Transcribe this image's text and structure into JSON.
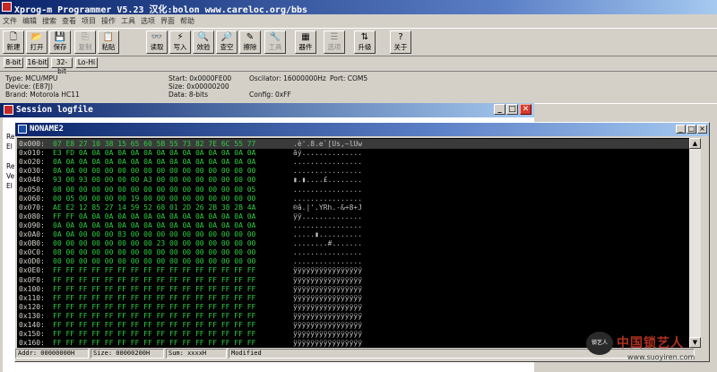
{
  "app": {
    "title": "Xprog-m Programmer V5.23 汉化:bolon  www.careloc.org/bbs"
  },
  "menu": [
    "文件",
    "编辑",
    "搜索",
    "查看",
    "项目",
    "操作",
    "工具",
    "选项",
    "界面",
    "帮助"
  ],
  "toolbar": {
    "buttons": [
      {
        "label": "新建",
        "icon": "new-file-icon",
        "glyph": "🗋",
        "enabled": true
      },
      {
        "label": "打开",
        "icon": "open-folder-icon",
        "glyph": "📂",
        "enabled": true
      },
      {
        "label": "保存",
        "icon": "save-icon",
        "glyph": "💾",
        "enabled": true
      },
      {
        "label": "复制",
        "icon": "copy-icon",
        "glyph": "⎘",
        "enabled": false
      },
      {
        "label": "粘贴",
        "icon": "paste-icon",
        "glyph": "📋",
        "enabled": true
      },
      {
        "label": "读取",
        "icon": "read-icon",
        "glyph": "👓",
        "enabled": true
      },
      {
        "label": "写入",
        "icon": "write-icon",
        "glyph": "⚡",
        "enabled": true
      },
      {
        "label": "效验",
        "icon": "verify-icon",
        "glyph": "🔍",
        "enabled": true
      },
      {
        "label": "查空",
        "icon": "blank-check-icon",
        "glyph": "🔎",
        "enabled": true
      },
      {
        "label": "擦除",
        "icon": "erase-icon",
        "glyph": "✎",
        "enabled": true
      },
      {
        "label": "工具",
        "icon": "tools-icon",
        "glyph": "🔧",
        "enabled": false
      },
      {
        "label": "器件",
        "icon": "device-chip-icon",
        "glyph": "▦",
        "enabled": true
      },
      {
        "label": "选项",
        "icon": "options-icon",
        "glyph": "☰",
        "enabled": false
      },
      {
        "label": "升级",
        "icon": "upgrade-icon",
        "glyph": "⇅",
        "enabled": true
      },
      {
        "label": "关于",
        "icon": "about-icon",
        "glyph": "?",
        "enabled": true
      }
    ]
  },
  "bit_buttons": [
    "8-bit",
    "16-bit",
    "32-bit",
    "Lo-Hi"
  ],
  "info": {
    "type": "Type: MCU/MPU",
    "device": "Device: (E87J)",
    "brand": "Brand: Motorola HC11",
    "start": "Start: 0x0000FE00",
    "size": "Size: 0x00000200",
    "data": "Data: 8-bits",
    "oscillator": "Oscilator: 16000000Hz",
    "config": "Config: 0xFF",
    "port": "Port: COM5"
  },
  "session": {
    "title": "Session logfile",
    "lines": [
      "Re",
      "El",
      "",
      "Re",
      "Ve",
      "El"
    ]
  },
  "editor": {
    "title": "NONAME2",
    "rows": [
      {
        "addr": "0x000:",
        "hex": "07 E8 27 10 38 15 65 60 5B 55 73 82 7E 6C 55 77",
        "ascii": ".è'.8.e`[Us‚~lUw",
        "selected": true
      },
      {
        "addr": "0x010:",
        "hex": "E3 FD 0A 0A 0A 0A 0A 0A 0A 0A 0A 0A 0A 0A 0A 0A",
        "ascii": "ãý..............",
        "selected": false
      },
      {
        "addr": "0x020:",
        "hex": "0A 0A 0A 0A 0A 0A 0A 0A 0A 0A 0A 0A 0A 0A 0A 0A",
        "ascii": "................",
        "selected": false
      },
      {
        "addr": "0x030:",
        "hex": "0A 0A 00 00 00 00 00 00 00 00 00 00 00 00 00 00",
        "ascii": "................",
        "selected": false
      },
      {
        "addr": "0x040:",
        "hex": "93 00 93 00 00 00 00 A3 00 00 00 00 00 00 00 00",
        "ascii": "▮.▮....£........",
        "selected": false
      },
      {
        "addr": "0x050:",
        "hex": "08 00 00 00 00 00 00 00 00 00 00 00 00 00 00 05",
        "ascii": "................",
        "selected": false
      },
      {
        "addr": "0x060:",
        "hex": "00 05 00 00 00 00 19 00 00 00 00 00 00 00 00 00",
        "ascii": "................",
        "selected": false
      },
      {
        "addr": "0x070:",
        "hex": "AE E2 12 85 27 14 59 52 68 01 2D 26 2B 38 2B 4A",
        "ascii": "®â.|'.YRh.-&+8+J",
        "selected": false
      },
      {
        "addr": "0x080:",
        "hex": "FF FF 0A 0A 0A 0A 0A 0A 0A 0A 0A 0A 0A 0A 0A 0A",
        "ascii": "ÿÿ..............",
        "selected": false
      },
      {
        "addr": "0x090:",
        "hex": "0A 0A 0A 0A 0A 0A 0A 0A 0A 0A 0A 0A 0A 0A 0A 0A",
        "ascii": "................",
        "selected": false
      },
      {
        "addr": "0x0A0:",
        "hex": "0A 0A 00 00 00 83 00 00 00 00 00 00 00 00 00 00",
        "ascii": ".....▮..........",
        "selected": false
      },
      {
        "addr": "0x0B0:",
        "hex": "00 00 00 00 00 00 00 00 23 00 00 00 00 00 00 00",
        "ascii": "........#.......",
        "selected": false
      },
      {
        "addr": "0x0C0:",
        "hex": "08 00 00 00 00 00 00 00 00 00 00 00 00 00 00 00",
        "ascii": "................",
        "selected": false
      },
      {
        "addr": "0x0D0:",
        "hex": "00 00 00 00 00 00 00 00 00 00 00 00 00 00 00 00",
        "ascii": "................",
        "selected": false
      },
      {
        "addr": "0x0E0:",
        "hex": "FF FF FF FF FF FF FF FF FF FF FF FF FF FF FF FF",
        "ascii": "ÿÿÿÿÿÿÿÿÿÿÿÿÿÿÿÿ",
        "selected": false
      },
      {
        "addr": "0x0F0:",
        "hex": "FF FF FF FF FF FF FF FF FF FF FF FF FF FF FF FF",
        "ascii": "ÿÿÿÿÿÿÿÿÿÿÿÿÿÿÿÿ",
        "selected": false
      },
      {
        "addr": "0x100:",
        "hex": "FF FF FF FF FF FF FF FF FF FF FF FF FF FF FF FF",
        "ascii": "ÿÿÿÿÿÿÿÿÿÿÿÿÿÿÿÿ",
        "selected": false
      },
      {
        "addr": "0x110:",
        "hex": "FF FF FF FF FF FF FF FF FF FF FF FF FF FF FF FF",
        "ascii": "ÿÿÿÿÿÿÿÿÿÿÿÿÿÿÿÿ",
        "selected": false
      },
      {
        "addr": "0x120:",
        "hex": "FF FF FF FF FF FF FF FF FF FF FF FF FF FF FF FF",
        "ascii": "ÿÿÿÿÿÿÿÿÿÿÿÿÿÿÿÿ",
        "selected": false
      },
      {
        "addr": "0x130:",
        "hex": "FF FF FF FF FF FF FF FF FF FF FF FF FF FF FF FF",
        "ascii": "ÿÿÿÿÿÿÿÿÿÿÿÿÿÿÿÿ",
        "selected": false
      },
      {
        "addr": "0x140:",
        "hex": "FF FF FF FF FF FF FF FF FF FF FF FF FF FF FF FF",
        "ascii": "ÿÿÿÿÿÿÿÿÿÿÿÿÿÿÿÿ",
        "selected": false
      },
      {
        "addr": "0x150:",
        "hex": "FF FF FF FF FF FF FF FF FF FF FF FF FF FF FF FF",
        "ascii": "ÿÿÿÿÿÿÿÿÿÿÿÿÿÿÿÿ",
        "selected": false
      },
      {
        "addr": "0x160:",
        "hex": "FF FF FF FF FF FF FF FF FF FF FF FF FF FF FF FF",
        "ascii": "ÿÿÿÿÿÿÿÿÿÿÿÿÿÿÿÿ",
        "selected": false
      }
    ]
  },
  "statusbar": {
    "addr": "Addr: 00000000H",
    "size": "Size: 00000200H",
    "sum": "Sum: xxxxH",
    "modified": "Modified"
  },
  "watermark": {
    "logo_text": "锁艺人",
    "title": "中国锁艺人",
    "url": "www.suoyiren.com"
  },
  "colors": {
    "title_active": "#0a246a",
    "hex_text": "#2ecc40",
    "editor_bg": "#000000"
  }
}
